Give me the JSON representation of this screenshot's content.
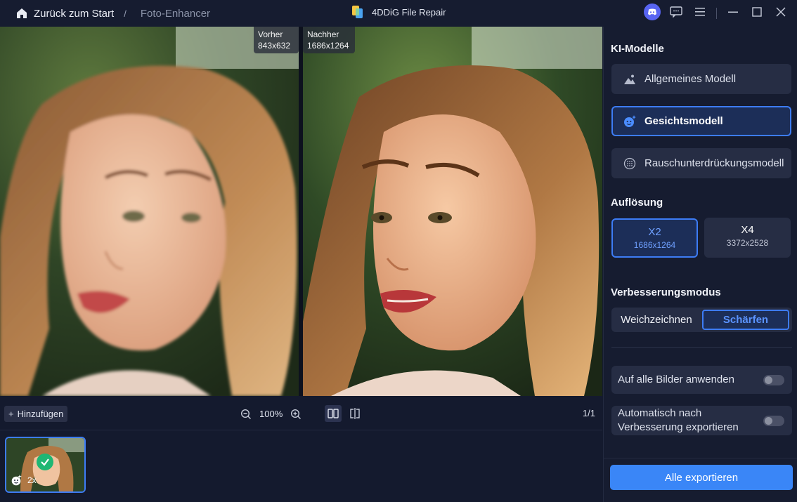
{
  "titlebar": {
    "home_label": "Zurück zum Start",
    "separator": "/",
    "breadcrumb": "Foto-Enhancer",
    "app_title": "4DDiG File Repair"
  },
  "compare": {
    "before_label": "Vorher",
    "before_size": "843x632",
    "after_label": "Nachher",
    "after_size": "1686x1264"
  },
  "viewbar": {
    "add_label": "Hinzufügen",
    "zoom_value": "100%",
    "page_count": "1/1"
  },
  "thumbnail": {
    "scale": "2x"
  },
  "panel": {
    "models_title": "KI-Modelle",
    "models": [
      {
        "label": "Allgemeines Modell",
        "icon": "landscape-icon",
        "active": false
      },
      {
        "label": "Gesichtsmodell",
        "icon": "face-sparkle-icon",
        "active": true
      },
      {
        "label": "Rauschunterdrückungsmodell",
        "icon": "noise-icon",
        "active": false
      }
    ],
    "resolution_title": "Auflösung",
    "resolutions": [
      {
        "label": "X2",
        "size": "1686x1264",
        "active": true
      },
      {
        "label": "X4",
        "size": "3372x2528",
        "active": false
      }
    ],
    "mode_title": "Verbesserungsmodus",
    "modes": [
      {
        "label": "Weichzeichnen",
        "active": false
      },
      {
        "label": "Schärfen",
        "active": true
      }
    ],
    "toggle_apply_all": "Auf alle Bilder anwenden",
    "toggle_auto_export_line1": "Automatisch nach",
    "toggle_auto_export_line2": "Verbesserung exportieren",
    "export_label": "Alle exportieren"
  },
  "colors": {
    "accent": "#3d7cf5",
    "background": "#141a2e",
    "panel": "#161c30",
    "success": "#1fb774"
  }
}
